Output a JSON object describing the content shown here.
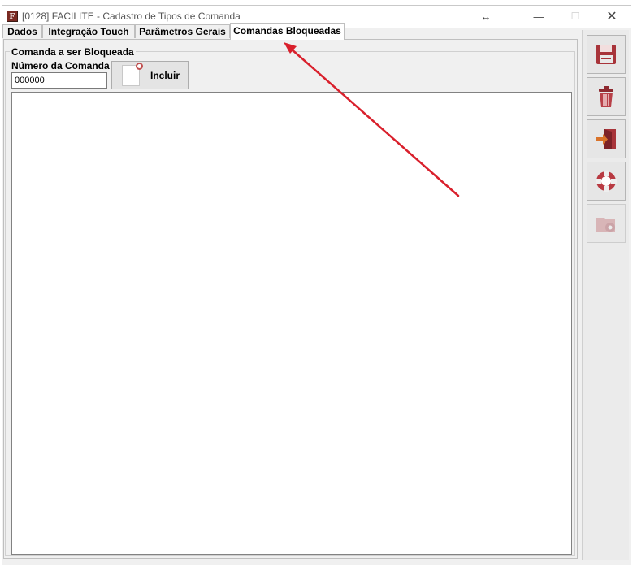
{
  "window": {
    "title": "[0128] FACILITE - Cadastro de Tipos de Comanda",
    "app_icon_glyph": "F",
    "resize_glyph": "↔",
    "minimize_glyph": "—",
    "maximize_glyph": "☐",
    "close_glyph": "✕"
  },
  "tabs": [
    {
      "label": "Dados",
      "active": false
    },
    {
      "label": "Integração Touch",
      "active": false
    },
    {
      "label": "Parâmetros Gerais",
      "active": false
    },
    {
      "label": "Comandas Bloqueadas",
      "active": true
    }
  ],
  "group": {
    "title": "Comanda a ser Bloqueada",
    "field_label": "Número da Comanda",
    "field_value": "000000",
    "button_label": "Incluir"
  },
  "side_buttons": [
    {
      "name": "save-button",
      "icon": "floppy-disk-icon",
      "enabled": true
    },
    {
      "name": "delete-button",
      "icon": "trash-can-icon",
      "enabled": true
    },
    {
      "name": "exit-button",
      "icon": "exit-door-icon",
      "enabled": true
    },
    {
      "name": "help-button",
      "icon": "lifebuoy-icon",
      "enabled": true
    },
    {
      "name": "config-button",
      "icon": "folder-gear-icon",
      "enabled": false
    }
  ],
  "colors": {
    "icon_red": "#a8343a",
    "arrow_red": "#d9202c"
  }
}
